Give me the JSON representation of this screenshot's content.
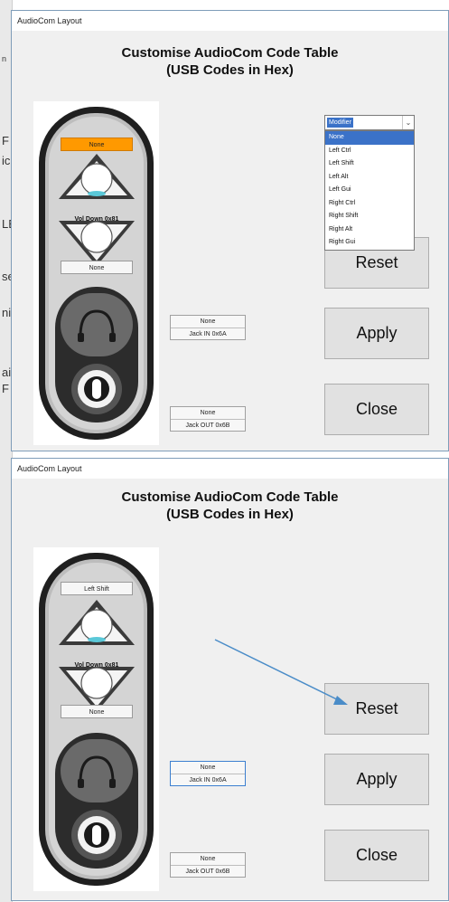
{
  "background_fragments": [
    "n",
    "F",
    "ic",
    "LE",
    "se",
    "ni",
    "ai",
    "F"
  ],
  "window1": {
    "title_bar": "AudioCom  Layout",
    "heading_line1": "Customise AudioCom  Code Table",
    "heading_line2": "(USB Codes in Hex)",
    "device": {
      "top_key_label": "None",
      "top_key_active": true,
      "middle_key_overlay": "Vol Down 0x81",
      "bottom_key_label": "None"
    },
    "jack_in": {
      "value": "None",
      "label": "Jack IN  0x6A"
    },
    "jack_out": {
      "value": "None",
      "label": "Jack OUT  0x6B"
    },
    "modifier_dropdown": {
      "selected": "Modifier",
      "options": [
        "None",
        "Left  Ctrl",
        "Left Shift",
        "Left    Alt",
        "Left   Gui",
        "Right  Ctrl",
        "Right Shift",
        "Right    Alt",
        "Right   Gui"
      ],
      "highlighted_index": 0
    },
    "buttons": {
      "reset": "Reset",
      "apply": "Apply",
      "close": "Close"
    }
  },
  "window2": {
    "title_bar": "AudioCom  Layout",
    "heading_line1": "Customise AudioCom  Code Table",
    "heading_line2": "(USB Codes in Hex)",
    "device": {
      "top_key_label": "Left Shift",
      "top_key_active": false,
      "middle_key_overlay": "Vol Down 0x81",
      "bottom_key_label": "None"
    },
    "jack_in": {
      "value": "None",
      "label": "Jack IN  0x6A",
      "selected": true
    },
    "jack_out": {
      "value": "None",
      "label": "Jack OUT  0x6B"
    },
    "buttons": {
      "reset": "Reset",
      "apply": "Apply",
      "close": "Close"
    }
  },
  "colors": {
    "active_key": "#ff9900",
    "selection_blue": "#3b72c8",
    "annotation_arrow": "#4a8cc8"
  }
}
